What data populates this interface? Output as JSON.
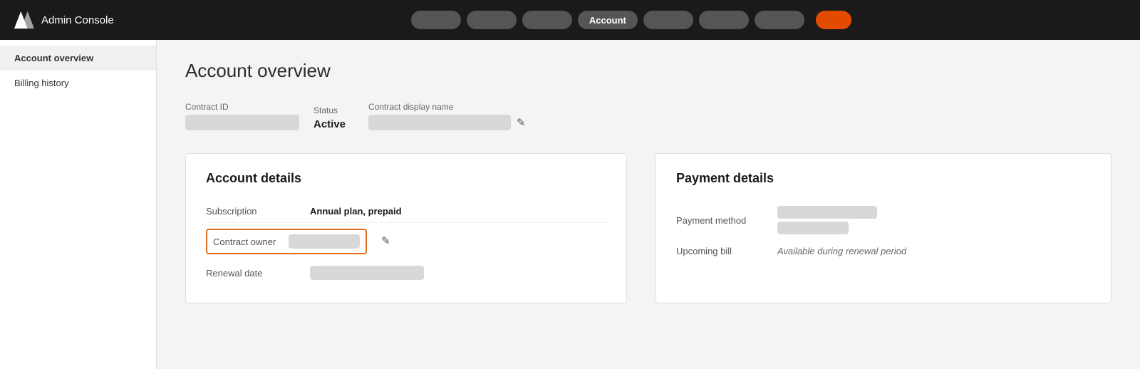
{
  "topNav": {
    "logoAlt": "Adobe",
    "appTitle": "Admin Console",
    "navItems": [
      {
        "label": "",
        "blank": true
      },
      {
        "label": "",
        "blank": true
      },
      {
        "label": "",
        "blank": true
      },
      {
        "label": "Account",
        "blank": false,
        "active": true
      },
      {
        "label": "",
        "blank": true
      },
      {
        "label": "",
        "blank": true
      },
      {
        "label": "",
        "blank": true
      },
      {
        "label": "",
        "blank": true
      }
    ]
  },
  "sidebar": {
    "items": [
      {
        "label": "Account overview",
        "active": true
      },
      {
        "label": "Billing history",
        "active": false
      }
    ]
  },
  "content": {
    "pageTitle": "Account overview",
    "contractFields": {
      "contractIdLabel": "Contract ID",
      "statusLabel": "Status",
      "statusValue": "Active",
      "displayNameLabel": "Contract display name"
    },
    "accountDetails": {
      "title": "Account details",
      "rows": [
        {
          "label": "Subscription",
          "value": "Annual plan, prepaid",
          "isBar": false
        },
        {
          "label": "Renewal date",
          "isBar": true
        }
      ],
      "contractOwner": {
        "label": "Contract owner"
      }
    },
    "paymentDetails": {
      "title": "Payment details",
      "paymentMethodLabel": "Payment method",
      "upcomingBillLabel": "Upcoming bill",
      "upcomingBillValue": "Available during renewal period"
    }
  },
  "icons": {
    "pencil": "✎",
    "adobeLogo": "A"
  }
}
